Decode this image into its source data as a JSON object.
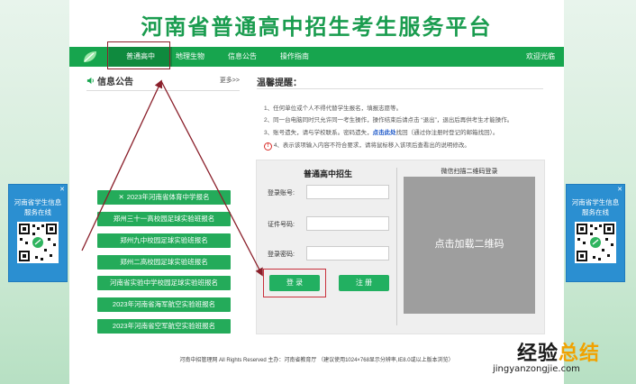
{
  "site_title": "河南省普通高中招生考生服务平台",
  "nav": {
    "items": [
      "普通高中",
      "地理生物",
      "信息公告",
      "操作指南"
    ],
    "welcome": "欢迎光临"
  },
  "notice": {
    "title": "信息公告",
    "more": "更多>>"
  },
  "tips": {
    "title": "温馨提醒：",
    "lines": [
      "1、任何单位或个人不得代替学生报名，填报志愿等。",
      "2、同一台电脑同时只允许同一考生操作，操作结束后请点击 “退出”，退出后再供考生才能操作。",
      "4、表示该项输入内容不符合要求，请将鼠标移入该项后查看出的说明修改。"
    ],
    "line3_prefix": "3、账号遗失，请与学校联系。密码遗失，",
    "line3_link": "点击此处",
    "line3_suffix": "找回（通过你注册时登记的邮箱找回）。",
    "warn_icon": "!"
  },
  "login": {
    "title": "普通高中招生",
    "account_label": "登录账号:",
    "idcard_label": "证件号码:",
    "password_label": "登录密码:",
    "login_button": "登 录",
    "register_button": "注 册"
  },
  "qr": {
    "title": "微信扫描二维码登录",
    "load_text": "点击加载二维码"
  },
  "links": [
    "2023年河南省体育中学报名",
    "郑州三十一高校园足球实验班报名",
    "郑州九中校园足球实验班报名",
    "郑州二高校园足球实验班报名",
    "河南省实验中学校园足球实验班报名",
    "2023年河南省海军航空实验班报名",
    "2023年河南省空军航空实验班报名"
  ],
  "side_card": {
    "text_line1": "河南省学生信息",
    "text_line2": "服务在线",
    "close": "✕"
  },
  "footer": "河南中招管理网 All Rights Reserved 主办：河南省教育厅 （建议使用1024×768显示分辨率,IE8.0或以上版本浏览）",
  "watermark": {
    "part1": "经验",
    "part2": "总结",
    "url": "jingyanzongjie.com"
  },
  "colors": {
    "brand": "#17a54e",
    "title": "#1a9c4f",
    "side_blue": "#2b8fd1",
    "arrow": "#8a1f2a"
  }
}
